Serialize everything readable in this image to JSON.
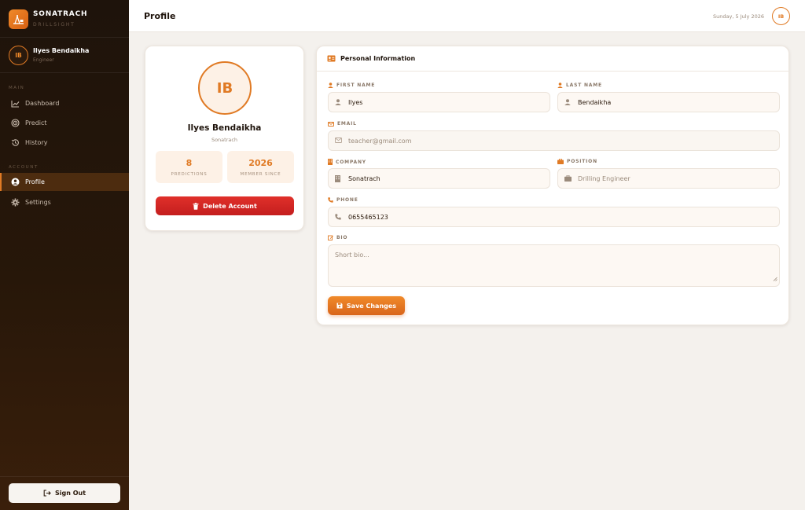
{
  "brand": {
    "name": "SONATRACH",
    "subtitle": "DRILLSIGHT"
  },
  "sidebar": {
    "user": {
      "initials": "IB",
      "name": "Ilyes Bendaikha",
      "role": "Engineer"
    },
    "main_label": "MAIN",
    "main_items": [
      {
        "label": "Dashboard",
        "icon": "chart-line-icon"
      },
      {
        "label": "Predict",
        "icon": "target-icon"
      },
      {
        "label": "History",
        "icon": "history-icon"
      }
    ],
    "account_label": "ACCOUNT",
    "account_items": [
      {
        "label": "Profile",
        "icon": "user-circle-icon",
        "active": true
      },
      {
        "label": "Settings",
        "icon": "gear-icon"
      }
    ],
    "signout_label": "Sign Out"
  },
  "topbar": {
    "title": "Profile",
    "date": "Sunday, 5 July 2026",
    "initials": "IB"
  },
  "profile": {
    "initials": "IB",
    "name": "Ilyes Bendaikha",
    "company": "Sonatrach",
    "stats": [
      {
        "value": "8",
        "label": "PREDICTIONS"
      },
      {
        "value": "2026",
        "label": "MEMBER SINCE"
      }
    ],
    "delete_label": "Delete Account"
  },
  "form": {
    "title": "Personal Information",
    "first_name": {
      "label": "FIRST NAME",
      "value": "Ilyes"
    },
    "last_name": {
      "label": "LAST NAME",
      "value": "Bendaikha"
    },
    "email": {
      "label": "EMAIL",
      "placeholder": "teacher@gmail.com"
    },
    "company": {
      "label": "COMPANY",
      "value": "Sonatrach"
    },
    "position": {
      "label": "POSITION",
      "placeholder": "Drilling Engineer"
    },
    "phone": {
      "label": "PHONE",
      "value": "0655465123"
    },
    "bio": {
      "label": "BIO",
      "placeholder": "Short bio..."
    },
    "save_label": "Save Changes"
  },
  "colors": {
    "accent": "#e07a24",
    "danger": "#d42424",
    "sidebar_bg": "#1e130b"
  }
}
